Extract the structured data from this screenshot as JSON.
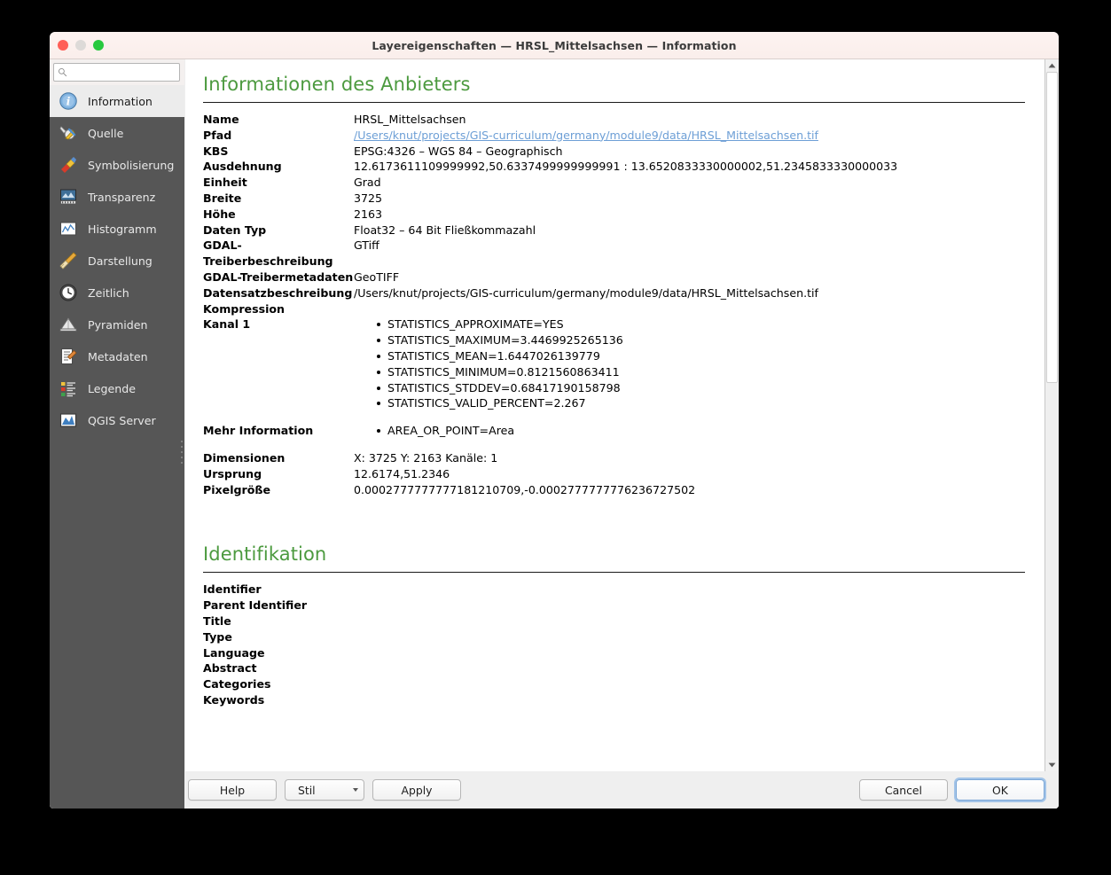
{
  "window": {
    "title": "Layereigenschaften — HRSL_Mittelsachsen — Information",
    "traffic_lights": {
      "close": "close-button",
      "minimize": "minimize-button",
      "maximize": "maximize-button"
    }
  },
  "sidebar": {
    "search": {
      "value": "",
      "placeholder": ""
    },
    "items": [
      {
        "label": "Information",
        "icon": "info-icon",
        "selected": true
      },
      {
        "label": "Quelle",
        "icon": "source-wrench-icon",
        "selected": false
      },
      {
        "label": "Symbolisierung",
        "icon": "symbology-brush-icon",
        "selected": false
      },
      {
        "label": "Transparenz",
        "icon": "transparency-icon",
        "selected": false
      },
      {
        "label": "Histogramm",
        "icon": "histogram-icon",
        "selected": false
      },
      {
        "label": "Darstellung",
        "icon": "rendering-broom-icon",
        "selected": false
      },
      {
        "label": "Zeitlich",
        "icon": "clock-icon",
        "selected": false
      },
      {
        "label": "Pyramiden",
        "icon": "pyramids-icon",
        "selected": false
      },
      {
        "label": "Metadaten",
        "icon": "metadata-pencil-icon",
        "selected": false
      },
      {
        "label": "Legende",
        "icon": "legend-icon",
        "selected": false
      },
      {
        "label": "QGIS Server",
        "icon": "qgis-server-icon",
        "selected": false
      }
    ]
  },
  "content": {
    "provider_section": {
      "heading": "Informationen des Anbieters",
      "rows": [
        {
          "key": "Name",
          "value": "HRSL_Mittelsachsen",
          "type": "text"
        },
        {
          "key": "Pfad",
          "value": "/Users/knut/projects/GIS-curriculum/germany/module9/data/HRSL_Mittelsachsen.tif",
          "type": "link"
        },
        {
          "key": "KBS",
          "value": "EPSG:4326 – WGS 84 – Geographisch",
          "type": "text"
        },
        {
          "key": "Ausdehnung",
          "value": "12.6173611109999992,50.6337499999999991 : 13.6520833330000002,51.2345833330000033",
          "type": "text"
        },
        {
          "key": "Einheit",
          "value": "Grad",
          "type": "text"
        },
        {
          "key": "Breite",
          "value": "3725",
          "type": "text"
        },
        {
          "key": "Höhe",
          "value": "2163",
          "type": "text"
        },
        {
          "key": "Daten Typ",
          "value": "Float32 – 64 Bit Fließkommazahl",
          "type": "text"
        },
        {
          "key": "GDAL-Treiberbeschreibung",
          "value": "GTiff",
          "type": "text"
        },
        {
          "key": "GDAL-Treibermetadaten",
          "value": "GeoTIFF",
          "type": "text"
        },
        {
          "key": "Datensatzbeschreibung",
          "value": "/Users/knut/projects/GIS-curriculum/germany/module9/data/HRSL_Mittelsachsen.tif",
          "type": "text"
        },
        {
          "key": "Kompression",
          "value": "",
          "type": "text"
        }
      ],
      "band_row": {
        "key": "Kanal 1",
        "items": [
          "STATISTICS_APPROXIMATE=YES",
          "STATISTICS_MAXIMUM=3.4469925265136",
          "STATISTICS_MEAN=1.6447026139779",
          "STATISTICS_MINIMUM=0.8121560863411",
          "STATISTICS_STDDEV=0.68417190158798",
          "STATISTICS_VALID_PERCENT=2.267"
        ]
      },
      "more_info_row": {
        "key": "Mehr Information",
        "items": [
          "AREA_OR_POINT=Area"
        ]
      },
      "tail_rows": [
        {
          "key": "Dimensionen",
          "value": "X: 3725 Y: 2163 Kanäle: 1"
        },
        {
          "key": "Ursprung",
          "value": "12.6174,51.2346"
        },
        {
          "key": "Pixelgröße",
          "value": "0.0002777777777181210709,-0.0002777777776236727502"
        }
      ]
    },
    "identification_section": {
      "heading": "Identifikation",
      "rows": [
        {
          "key": "Identifier",
          "value": ""
        },
        {
          "key": "Parent Identifier",
          "value": ""
        },
        {
          "key": "Title",
          "value": ""
        },
        {
          "key": "Type",
          "value": ""
        },
        {
          "key": "Language",
          "value": ""
        },
        {
          "key": "Abstract",
          "value": ""
        },
        {
          "key": "Categories",
          "value": ""
        },
        {
          "key": "Keywords",
          "value": ""
        }
      ]
    }
  },
  "buttons": {
    "help": "Help",
    "style": "Stil",
    "apply": "Apply",
    "cancel": "Cancel",
    "ok": "OK"
  },
  "colors": {
    "heading_green": "#4c9a3f",
    "link_blue": "#6d9fd6",
    "sidebar_bg": "#565656",
    "selected_bg": "#ececec",
    "titlebar_bg": "#fdf3f1"
  }
}
